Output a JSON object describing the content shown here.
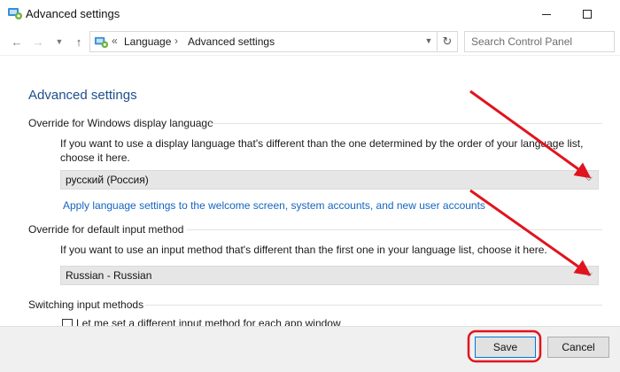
{
  "window": {
    "title": "Advanced settings",
    "icon": "control-panel-icon",
    "controls": {
      "minimize_icon": "minimize-icon",
      "maximize_icon": "maximize-icon"
    }
  },
  "navbar": {
    "back_icon": "back-arrow-icon",
    "forward_icon": "forward-arrow-icon",
    "recent_icon": "chevron-down-icon",
    "up_icon": "up-arrow-icon",
    "breadcrumb_prefix": "«",
    "breadcrumb": [
      "Language",
      "Advanced settings"
    ],
    "breadcrumb_separator": "›",
    "refresh_icon": "refresh-icon",
    "search_placeholder": "Search Control Panel"
  },
  "main": {
    "page_title": "Advanced settings",
    "display_language": {
      "heading": "Override for Windows display language",
      "description": "If you want to use a display language that's different than the one determined by the order of your language list, choose it here.",
      "selected": "русский (Россия)",
      "link": "Apply language settings to the welcome screen, system accounts, and new user accounts"
    },
    "input_method": {
      "heading": "Override for default input method",
      "description": "If you want to use an input method that's different than the first one in your language list, choose it here.",
      "selected": "Russian - Russian"
    },
    "switching": {
      "heading": "Switching input methods",
      "checkbox_label": "Let me set a different input method for each app window",
      "checked": false
    }
  },
  "footer": {
    "save_label": "Save",
    "cancel_label": "Cancel"
  },
  "colors": {
    "title_blue": "#1f4e8c",
    "link_blue": "#1565c0",
    "annotation_red": "#e0141e"
  }
}
